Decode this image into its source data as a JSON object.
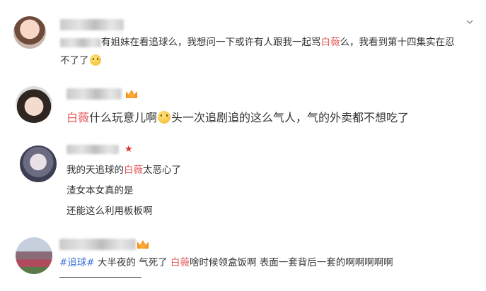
{
  "comments": [
    {
      "text_line1_pre": "有姐妹在看追球么，我想问一下或许有人跟我一起骂",
      "text_line1_hl": "白薇",
      "text_line1_post": "么，我看到第十四集实在忍",
      "text_line2": "不了了"
    },
    {
      "hl": "白薇",
      "text_pre": "什么玩意儿啊",
      "text_post": "头一次追剧追的这么气人，气的外卖都不想吃了"
    },
    {
      "line1_pre": "我的天追球的",
      "line1_hl": "白薇",
      "line1_post": "太恶心了",
      "line2": "渣女本女真的是",
      "line3": "还能这么利用板板啊"
    },
    {
      "tag": "#追球#",
      "text_pre": " 大半夜的 气死了 ",
      "hl": "白薇",
      "text_post": "啥时候领盒饭啊 表面一套背后一套的啊啊啊啊啊"
    }
  ],
  "icons": {
    "expand": "chevron-down-icon",
    "emoji_smile": "smile-emoji-icon",
    "emoji_angry": "clap-emoji-icon",
    "crown": "crown-icon",
    "star": "star-icon"
  },
  "colors": {
    "highlight": "#e35a5a",
    "tag": "#3b6fd6",
    "text": "#333333"
  }
}
